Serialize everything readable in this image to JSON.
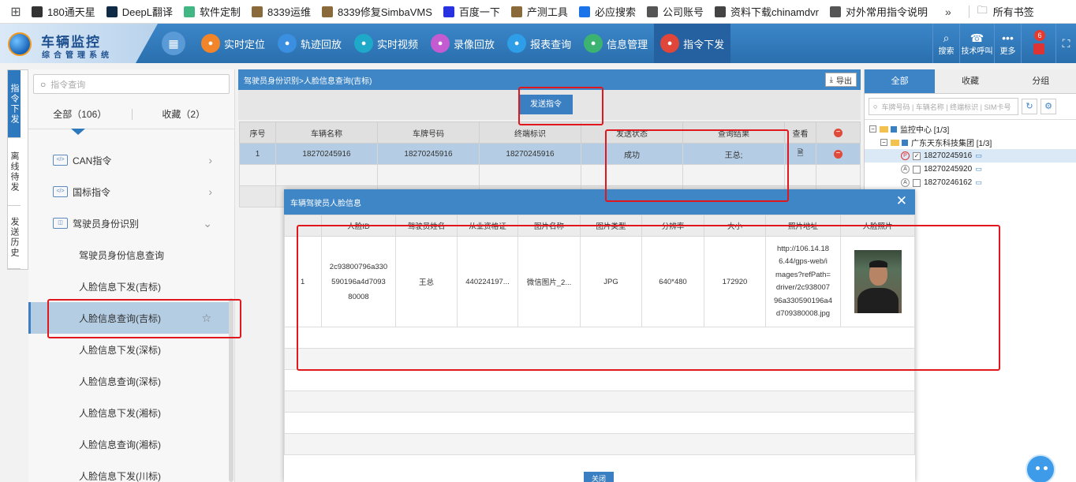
{
  "bookmarks": [
    {
      "label": "180通天星",
      "color": "#333333"
    },
    {
      "label": "DeepL翻译",
      "color": "#0f2b46"
    },
    {
      "label": "软件定制",
      "color": "#41b883"
    },
    {
      "label": "8339运维",
      "color": "#8a6a3a"
    },
    {
      "label": "8339修复SimbaVMS",
      "color": "#8a6a3a"
    },
    {
      "label": "百度一下",
      "color": "#2932e1"
    },
    {
      "label": "产测工具",
      "color": "#8a6a3a"
    },
    {
      "label": "必应搜索",
      "color": "#1a73e8"
    },
    {
      "label": "公司账号",
      "color": "#555555"
    },
    {
      "label": "资料下载chinamdvr",
      "color": "#444444"
    },
    {
      "label": "对外常用指令说明",
      "color": "#555555"
    }
  ],
  "bookmarks_all": "所有书签",
  "app": {
    "title": "车辆监控",
    "subtitle": "综合管理系统"
  },
  "nav": [
    {
      "label": "实时定位",
      "color": "#f2852a",
      "icon": "location-icon"
    },
    {
      "label": "轨迹回放",
      "color": "#3b8fe0",
      "icon": "track-icon"
    },
    {
      "label": "实时视频",
      "color": "#1fa9c9",
      "icon": "play-icon"
    },
    {
      "label": "录像回放",
      "color": "#c45bd1",
      "icon": "replay-icon"
    },
    {
      "label": "报表查询",
      "color": "#2e9ee8",
      "icon": "report-icon"
    },
    {
      "label": "信息管理",
      "color": "#3cb371",
      "icon": "info-icon"
    },
    {
      "label": "指令下发",
      "color": "#e0473a",
      "icon": "flag-icon"
    }
  ],
  "header_right": [
    {
      "label": "搜索",
      "icon": "search-icon"
    },
    {
      "label": "技术呼叫",
      "icon": "user-icon"
    },
    {
      "label": "更多",
      "icon": "more-icon"
    }
  ],
  "alarm_count": "6",
  "side_tabs": [
    "指令下发",
    "离线待发",
    "发送历史"
  ],
  "left": {
    "search_placeholder": "指令查询",
    "tab_all": "全部（106）",
    "tab_fav": "收藏（2）",
    "menu": [
      {
        "label": "CAN指令"
      },
      {
        "label": "国标指令"
      },
      {
        "label": "驾驶员身份识别"
      }
    ],
    "submenu": [
      "驾驶员身份信息查询",
      "人脸信息下发(吉标)",
      "人脸信息查询(吉标)",
      "人脸信息下发(深标)",
      "人脸信息查询(深标)",
      "人脸信息下发(湘标)",
      "人脸信息查询(湘标)",
      "人脸信息下发(川标)"
    ]
  },
  "main": {
    "breadcrumb": "驾驶员身份识别>人脸信息查询(吉标)",
    "export": "导出",
    "send_button": "发送指令",
    "columns": [
      "序号",
      "车辆名称",
      "车牌号码",
      "终端标识",
      "发送状态",
      "查询结果",
      "查看"
    ],
    "rows": [
      {
        "no": "1",
        "name": "18270245916",
        "plate": "18270245916",
        "terminal": "18270245916",
        "status": "成功",
        "result": "王总;"
      }
    ]
  },
  "right": {
    "tabs": [
      "全部",
      "收藏",
      "分组"
    ],
    "search_placeholder": "车牌号码 | 车辆名称 | 终端标识 | SIM卡号",
    "tree": [
      {
        "label": "监控中心 [1/3]"
      },
      {
        "label": "广东天东科技集团 [1/3]"
      },
      {
        "label": "18270245916",
        "state": "P",
        "checked": true
      },
      {
        "label": "18270245920",
        "state": "A",
        "checked": false
      },
      {
        "label": "18270246162",
        "state": "A",
        "checked": false
      }
    ]
  },
  "modal": {
    "title": "车辆驾驶员人脸信息",
    "columns": [
      "人脸ID",
      "驾驶员姓名",
      "从业资格证",
      "图片名称",
      "图片类型",
      "分辨率",
      "大小",
      "照片地址",
      "人脸照片"
    ],
    "row": {
      "no": "1",
      "face_id_lines": [
        "2c93800796a330",
        "590196a4d7093",
        "80008"
      ],
      "driver": "王总",
      "cert": "440224197...",
      "pic_name": "微信图片_2...",
      "pic_type": "JPG",
      "resolution": "640*480",
      "size": "172920",
      "url_lines": [
        "http://106.14.18",
        "6.44/gps-web/i",
        "mages?refPath=",
        "driver/2c938007",
        "96a330590196a4",
        "d709380008.jpg"
      ]
    },
    "close_button": "关闭"
  }
}
